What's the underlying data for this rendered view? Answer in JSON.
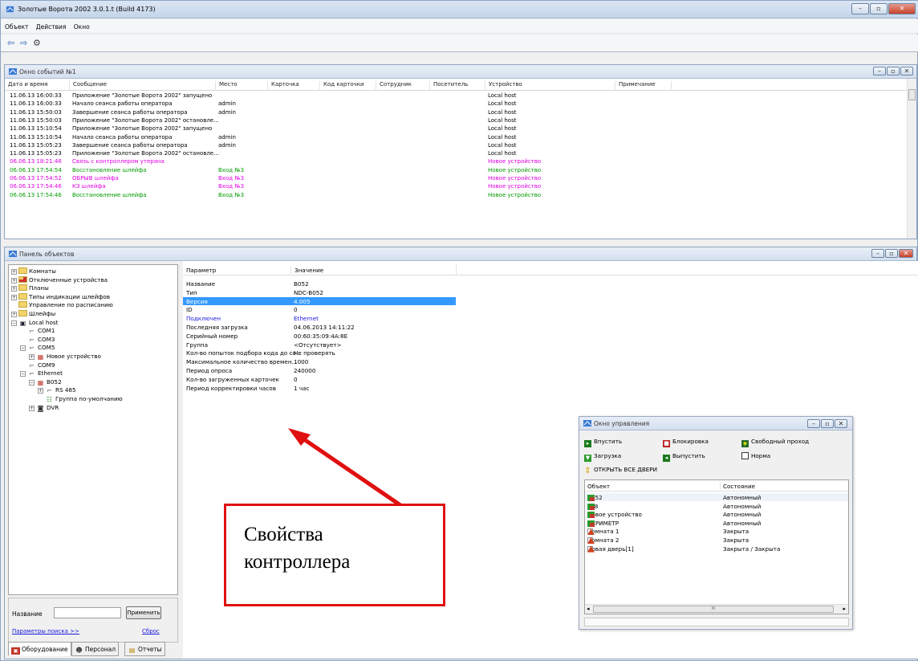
{
  "app": {
    "title": "Золотые Ворота 2002 3.0.1.t (Build 4173)",
    "window_controls": {
      "minimize": "–",
      "restore": "▫",
      "close": "✕"
    }
  },
  "menu": [
    "Объект",
    "Действия",
    "Окно"
  ],
  "toolbar": {
    "back": "⇦",
    "forward": "⇨",
    "settings": "⚙"
  },
  "events_window": {
    "title": "Окно событий №1",
    "columns": [
      "Дата и время",
      "Сообщение",
      "Место",
      "Карточка",
      "Код карточки",
      "Сотрудник",
      "Посетитель",
      "Устройство",
      "Примечание"
    ],
    "rows": [
      {
        "dt": "11.06.13 16:00:33",
        "msg": "Приложение \"Золотые Ворота 2002\" запущено",
        "place": "",
        "device": "Local host",
        "color": "#000000"
      },
      {
        "dt": "11.06.13 16:00:33",
        "msg": "Начало сеанса работы оператора",
        "place": "admin",
        "device": "Local host",
        "color": "#000000"
      },
      {
        "dt": "11.06.13 15:50:03",
        "msg": "Завершение сеанса работы оператора",
        "place": "admin",
        "device": "Local host",
        "color": "#000000"
      },
      {
        "dt": "11.06.13 15:50:03",
        "msg": "Приложение \"Золотые Ворота 2002\" остановле...",
        "place": "",
        "device": "Local host",
        "color": "#000000"
      },
      {
        "dt": "11.06.13 15:10:54",
        "msg": "Приложение \"Золотые Ворота 2002\" запущено",
        "place": "",
        "device": "Local host",
        "color": "#000000"
      },
      {
        "dt": "11.06.13 15:10:54",
        "msg": "Начало сеанса работы оператора",
        "place": "admin",
        "device": "Local host",
        "color": "#000000"
      },
      {
        "dt": "11.06.13 15:05:23",
        "msg": "Завершение сеанса работы оператора",
        "place": "admin",
        "device": "Local host",
        "color": "#000000"
      },
      {
        "dt": "11.06.13 15:05:23",
        "msg": "Приложение \"Золотые Ворота 2002\" остановле...",
        "place": "",
        "device": "Local host",
        "color": "#000000"
      },
      {
        "dt": "06.06.13 18:21:46",
        "msg": "Связь с контроллером утеряна",
        "place": "",
        "device": "Новое устройство",
        "color": "#e000e0"
      },
      {
        "dt": "06.06.13 17:54:54",
        "msg": "Восстановление шлейфа",
        "place": "Вход №3",
        "device": "Новое устройство",
        "color": "#009a00"
      },
      {
        "dt": "06.06.13 17:54:52",
        "msg": "ОБРЫВ шлейфа",
        "place": "Вход №3",
        "device": "Новое устройство",
        "color": "#e000e0"
      },
      {
        "dt": "06.06.13 17:54:46",
        "msg": "КЗ шлейфа",
        "place": "Вход №3",
        "device": "Новое устройство",
        "color": "#e000e0"
      },
      {
        "dt": "06.06.13 17:54:46",
        "msg": "Восстановление шлейфа",
        "place": "Вход №3",
        "device": "Новое устройство",
        "color": "#009a00"
      }
    ]
  },
  "objects_panel": {
    "title": "Панель объектов",
    "tree": [
      {
        "label": "Комнаты",
        "icon": "folder",
        "level": 0,
        "expander": "+"
      },
      {
        "label": "Отключенные устройства",
        "icon": "folder-red",
        "level": 0,
        "expander": "+"
      },
      {
        "label": "Планы",
        "icon": "folder",
        "level": 0,
        "expander": "+"
      },
      {
        "label": "Типы индикации шлейфов",
        "icon": "folder",
        "level": 0,
        "expander": "+"
      },
      {
        "label": "Управление по расписанию",
        "icon": "folder",
        "level": 0,
        "expander": ""
      },
      {
        "label": "Шлейфы",
        "icon": "folder",
        "level": 0,
        "expander": "+"
      },
      {
        "label": "Local host",
        "icon": "computer",
        "level": 0,
        "expander": "−"
      },
      {
        "label": "COM1",
        "icon": "port",
        "level": 1,
        "expander": ""
      },
      {
        "label": "COM3",
        "icon": "port",
        "level": 1,
        "expander": ""
      },
      {
        "label": "COM5",
        "icon": "port",
        "level": 1,
        "expander": "−"
      },
      {
        "label": "Новое устройство",
        "icon": "device",
        "level": 2,
        "expander": "+"
      },
      {
        "label": "COM9",
        "icon": "port",
        "level": 1,
        "expander": ""
      },
      {
        "label": "Ethernet",
        "icon": "port",
        "level": 1,
        "expander": "−"
      },
      {
        "label": "B052",
        "icon": "device",
        "level": 2,
        "expander": "−"
      },
      {
        "label": "RS 485",
        "icon": "port",
        "level": 3,
        "expander": "+"
      },
      {
        "label": "Группа по-умолчанию",
        "icon": "group",
        "level": 3,
        "expander": ""
      },
      {
        "label": "DVR",
        "icon": "camera",
        "level": 2,
        "expander": "+"
      }
    ],
    "search": {
      "label": "Название",
      "value": "",
      "apply": "Применить",
      "params_link": "Параметры поиска >>",
      "reset": "Сброс"
    },
    "tabs": [
      "Оборудование",
      "Персонал",
      "Отчеты"
    ]
  },
  "properties": {
    "col_param": "Параметр",
    "col_value": "Значение",
    "rows": [
      {
        "name": "Название",
        "value": "B052",
        "style": "normal"
      },
      {
        "name": "Тип",
        "value": "NDC-B052",
        "style": "normal"
      },
      {
        "name": "Версия",
        "value": "4.005",
        "style": "selected"
      },
      {
        "name": "ID",
        "value": "0",
        "style": "normal"
      },
      {
        "name": "Подключен",
        "value": "Ethernet",
        "style": "link"
      },
      {
        "name": "Последняя загрузка",
        "value": "04.06.2013 14:11:22",
        "style": "normal"
      },
      {
        "name": "Серийный номер",
        "value": "00:60:35:09:4A:8E",
        "style": "normal"
      },
      {
        "name": "Группа",
        "value": "<Отсутствует>",
        "style": "normal"
      },
      {
        "name": "Кол-во попыток подбора кода до со...",
        "value": "Не проверять",
        "style": "normal"
      },
      {
        "name": "Максимальное количество времен...",
        "value": "1000",
        "style": "normal"
      },
      {
        "name": "Период опроса",
        "value": "240000",
        "style": "normal"
      },
      {
        "name": "Кол-во загруженных карточек",
        "value": "0",
        "style": "normal"
      },
      {
        "name": "Период корректировки часов",
        "value": "1 час",
        "style": "normal"
      }
    ],
    "selected_color": "#3399ff",
    "link_color": "#1a1adf"
  },
  "control_window": {
    "title": "Окно управления",
    "buttons": [
      "Впустить",
      "Блокировка",
      "Свободный проход",
      "Загрузка",
      "Выпустить",
      "Норма"
    ],
    "open_all": "ОТКРЫТЬ ВСЕ ДВЕРИ",
    "columns": [
      "Объект",
      "Состояние"
    ],
    "rows": [
      {
        "object": "B052",
        "state": "Автономный",
        "icon": "device"
      },
      {
        "object": "F18",
        "state": "Автономный",
        "icon": "device"
      },
      {
        "object": "Новое устройство",
        "state": "Автономный",
        "icon": "device"
      },
      {
        "object": "ПЕРИМЕТР",
        "state": "Автономный",
        "icon": "device"
      },
      {
        "object": "Комната 1",
        "state": "Закрыта",
        "icon": "door"
      },
      {
        "object": "Комната 2",
        "state": "Закрыта",
        "icon": "door"
      },
      {
        "object": "Новая дверь[1]",
        "state": "Закрыта / Закрыта",
        "icon": "door"
      }
    ],
    "scroll_label": "III"
  },
  "annotation": {
    "line1": "Свойства",
    "line2": "контроллера",
    "color": "#e01010"
  }
}
